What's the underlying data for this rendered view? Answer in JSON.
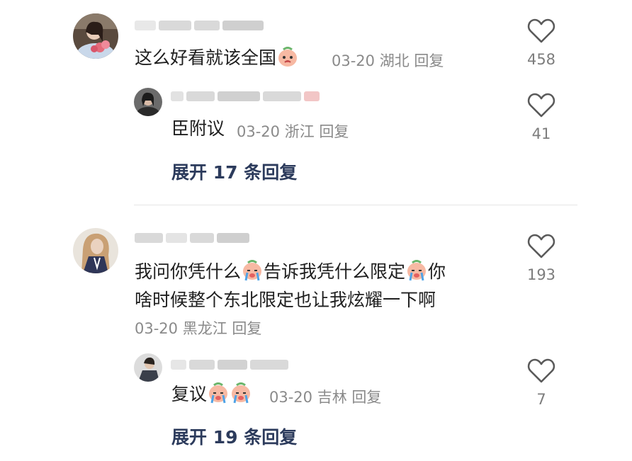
{
  "comments": [
    {
      "text": "这么好看就该全国",
      "date": "03-20",
      "location": "湖北",
      "reply_label": "回复",
      "likes": "458",
      "avatar_icon": "woman-with-flowers-avatar",
      "emoji_icon": "crying-peach-emoji",
      "replies": [
        {
          "text": "臣附议",
          "date": "03-20",
          "location": "浙江",
          "reply_label": "回复",
          "likes": "41",
          "avatar_icon": "dark-hair-avatar"
        }
      ],
      "expand_label": "展开 17 条回复"
    },
    {
      "text_line1_parts": [
        "我问你凭什么",
        "告诉我凭什么限定",
        "你"
      ],
      "text_line2": "啥时候整个东北限定也让我炫耀一下啊",
      "date": "03-20",
      "location": "黑龙江",
      "reply_label": "回复",
      "likes": "193",
      "avatar_icon": "long-hair-girl-avatar",
      "emoji_icon": "crying-peach-emoji",
      "replies": [
        {
          "text": "复议",
          "date": "03-20",
          "location": "吉林",
          "reply_label": "回复",
          "likes": "7",
          "avatar_icon": "person-in-jacket-avatar"
        }
      ],
      "expand_label": "展开 19 条回复"
    }
  ],
  "colors": {
    "text": "#1f1f1f",
    "meta": "#8a8a8a",
    "expand": "#2c3b5c",
    "heart_stroke": "#5a5a5a"
  }
}
